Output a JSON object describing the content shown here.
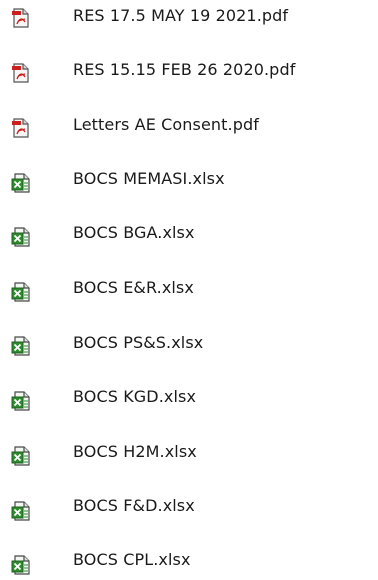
{
  "files": [
    {
      "name": "RES 17.5 MAY 19 2021.pdf",
      "icon": "pdf-file-icon"
    },
    {
      "name": "RES 15.15 FEB 26 2020.pdf",
      "icon": "pdf-file-icon"
    },
    {
      "name": "Letters AE Consent.pdf",
      "icon": "pdf-file-icon"
    },
    {
      "name": "BOCS MEMASI.xlsx",
      "icon": "excel-file-icon"
    },
    {
      "name": "BOCS BGA.xlsx",
      "icon": "excel-file-icon"
    },
    {
      "name": "BOCS E&R.xlsx",
      "icon": "excel-file-icon"
    },
    {
      "name": "BOCS PS&S.xlsx",
      "icon": "excel-file-icon"
    },
    {
      "name": "BOCS KGD.xlsx",
      "icon": "excel-file-icon"
    },
    {
      "name": "BOCS H2M.xlsx",
      "icon": "excel-file-icon"
    },
    {
      "name": "BOCS F&D.xlsx",
      "icon": "excel-file-icon"
    },
    {
      "name": "BOCS CPL.xlsx",
      "icon": "excel-file-icon"
    }
  ],
  "colors": {
    "pdf_accent": "#cc1f1f",
    "excel_accent": "#2e8b2e",
    "text": "#1a1a1a"
  }
}
